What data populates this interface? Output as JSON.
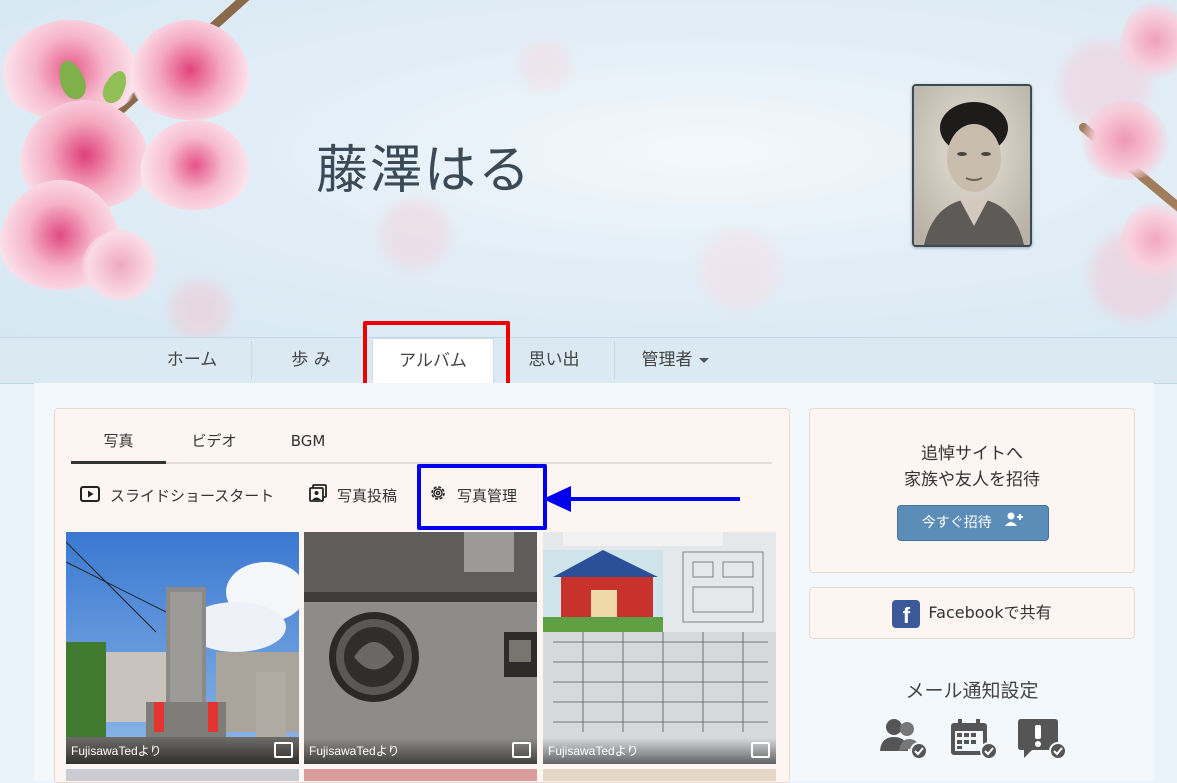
{
  "site": {
    "title": "藤澤はる"
  },
  "nav": {
    "items": [
      {
        "label": "ホーム"
      },
      {
        "label": "歩 み"
      },
      {
        "label": "アルバム",
        "active": true
      },
      {
        "label": "思い出"
      },
      {
        "label": "管理者"
      }
    ]
  },
  "album": {
    "tabs": [
      {
        "label": "写真",
        "active": true
      },
      {
        "label": "ビデオ"
      },
      {
        "label": "BGM"
      }
    ],
    "actions": {
      "slideshow": "スライドショースタート",
      "post": "写真投稿",
      "manage": "写真管理"
    },
    "photos": [
      {
        "caption": "FujisawaTedより"
      },
      {
        "caption": "FujisawaTedより"
      },
      {
        "caption": "FujisawaTedより"
      }
    ]
  },
  "sidebar": {
    "invite": {
      "title_line1": "追悼サイトへ",
      "title_line2": "家族や友人を招待",
      "button": "今すぐ招待"
    },
    "facebook": {
      "label": "Facebookで共有"
    },
    "mail": {
      "title": "メール通知設定"
    }
  },
  "colors": {
    "highlight_red": "#ee0000",
    "highlight_blue": "#0000ee",
    "invite_button": "#5b8db8",
    "facebook": "#3b5998"
  }
}
